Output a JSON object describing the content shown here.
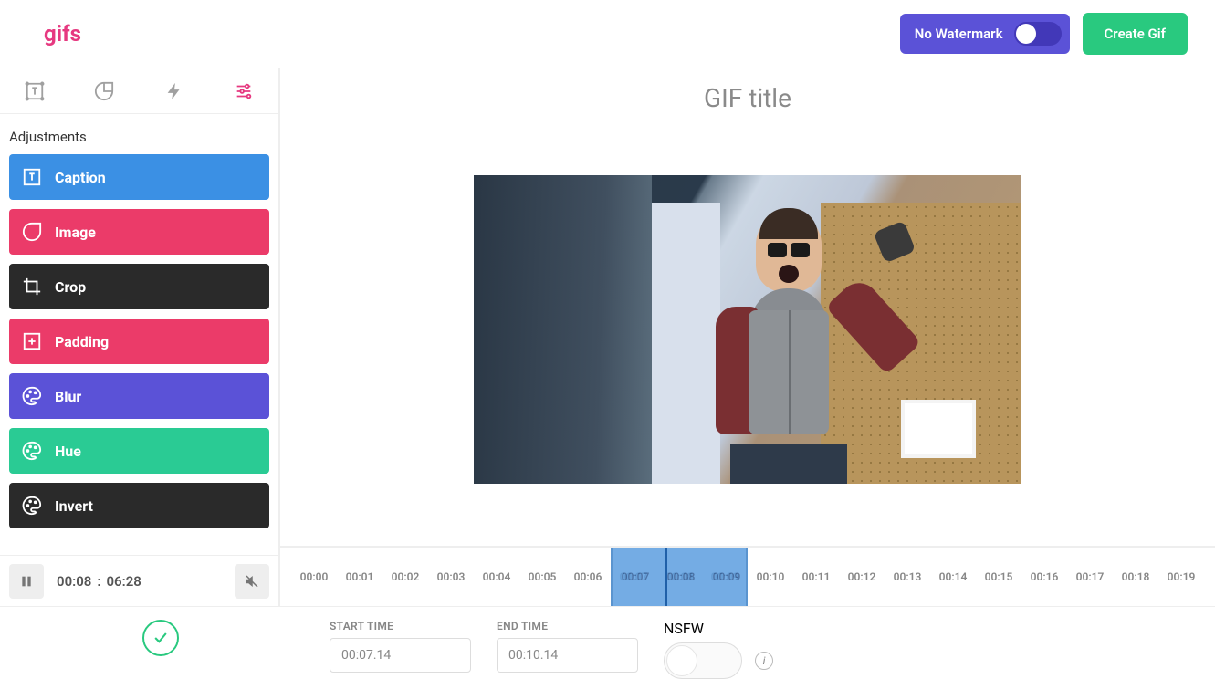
{
  "header": {
    "logo": "gifs",
    "watermark_label": "No Watermark",
    "create_label": "Create Gif"
  },
  "adjustments": {
    "heading": "Adjustments",
    "items": [
      {
        "label": "Caption",
        "color": "c-blue"
      },
      {
        "label": "Image",
        "color": "c-pink"
      },
      {
        "label": "Crop",
        "color": "c-dark"
      },
      {
        "label": "Padding",
        "color": "c-pink"
      },
      {
        "label": "Blur",
        "color": "c-purple"
      },
      {
        "label": "Hue",
        "color": "c-green"
      },
      {
        "label": "Invert",
        "color": "c-dark"
      }
    ]
  },
  "playback": {
    "current": "00:08",
    "separator": ":",
    "total": "06:28"
  },
  "preview": {
    "title_placeholder": "GIF title"
  },
  "timeline": {
    "ticks": [
      "00:00",
      "00:01",
      "00:02",
      "00:03",
      "00:04",
      "00:05",
      "00:06",
      "00:07",
      "00:08",
      "00:09",
      "00:10",
      "00:11",
      "00:12",
      "00:13",
      "00:14",
      "00:15",
      "00:16",
      "00:17",
      "00:18",
      "00:19"
    ],
    "selection_start_index": 7,
    "selection_end_index": 9
  },
  "controls": {
    "start_label": "START TIME",
    "start_value": "00:07.14",
    "end_label": "END TIME",
    "end_value": "00:10.14",
    "nsfw_label": "NSFW",
    "nsfw_value": "OFF"
  }
}
